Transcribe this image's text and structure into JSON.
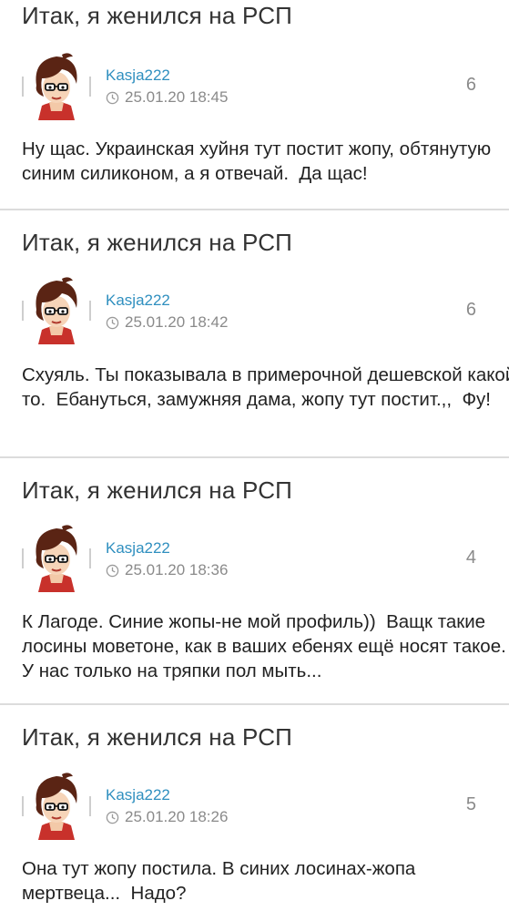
{
  "posts": [
    {
      "title": "Итак, я женился на РСП",
      "author": "Kasja222",
      "datetime": "25.01.20 18:45",
      "count": "6",
      "text": "Ну щас. Украинская хуйня тут постит жопу, обтянутую синим силиконом, а я отвечай.  Да щас!"
    },
    {
      "title": "Итак, я женился на РСП",
      "author": "Kasja222",
      "datetime": "25.01.20 18:42",
      "count": "6",
      "text": "Схуяль. Ты показывала в примерочной дешевской какой то.  Ебануться, замужняя дама, жопу тут постит.,,  Фу!"
    },
    {
      "title": "Итак, я женился на РСП",
      "author": "Kasja222",
      "datetime": "25.01.20 18:36",
      "count": "4",
      "text": "К Лагоде. Синие жопы-не мой профиль))  Ващк такие лосины моветоне, как в ваших ебенях ещё носят такое. У нас только на тряпки пол мыть..."
    },
    {
      "title": "Итак, я женился на РСП",
      "author": "Kasja222",
      "datetime": "25.01.20 18:26",
      "count": "5",
      "text": "Она тут жопу постила. В синих лосинах-жопа мертвеца...  Надо?"
    }
  ],
  "icons": {
    "avatar": "cartoon-woman-avatar-icon",
    "time": "clock-icon"
  },
  "colors": {
    "author_link": "#2f8fbf",
    "meta_text": "#8a8a8a",
    "divider": "#dcdcdc",
    "title_text": "#333333"
  }
}
